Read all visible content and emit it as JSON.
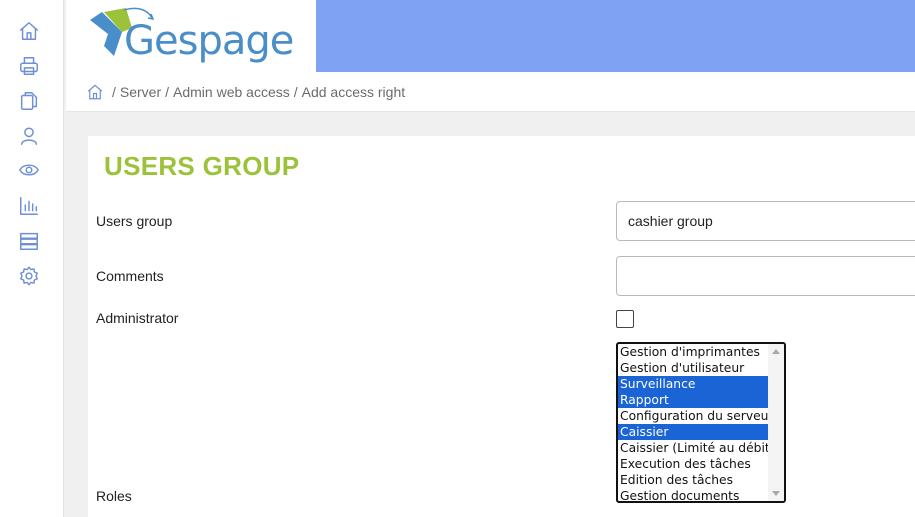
{
  "sidebar": {
    "icons": [
      "home-icon",
      "printer-icon",
      "documents-icon",
      "user-icon",
      "eye-icon",
      "chart-icon",
      "server-icon",
      "settings-icon"
    ]
  },
  "brand": {
    "logo_text": "Gespage"
  },
  "colors": {
    "accent": "#7fa2f2",
    "title": "#9cc23a",
    "selection": "#1a64d6",
    "icon": "#6e8fd8"
  },
  "breadcrumb": {
    "items": [
      "Server",
      "Admin web access",
      "Add access right"
    ],
    "separator": "/"
  },
  "form": {
    "title": "USERS GROUP",
    "users_group_label": "Users group",
    "users_group_value": "cashier group",
    "comments_label": "Comments",
    "comments_value": "",
    "administrator_label": "Administrator",
    "administrator_checked": false,
    "roles_label": "Roles",
    "roles_options": [
      {
        "label": "Gestion d'imprimantes",
        "selected": false
      },
      {
        "label": "Gestion d'utilisateur",
        "selected": false
      },
      {
        "label": "Surveillance",
        "selected": true
      },
      {
        "label": "Rapport",
        "selected": true
      },
      {
        "label": "Configuration du serveur",
        "selected": false
      },
      {
        "label": "Caissier",
        "selected": true
      },
      {
        "label": "Caissier (Limité au débit)",
        "selected": false
      },
      {
        "label": "Execution des tâches",
        "selected": false
      },
      {
        "label": "Edition des tâches",
        "selected": false
      },
      {
        "label": "Gestion documents",
        "selected": false
      }
    ]
  }
}
